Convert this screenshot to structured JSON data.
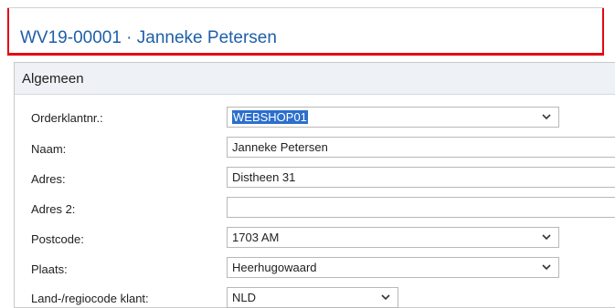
{
  "header": {
    "title": "WV19-00001 · Janneke Petersen"
  },
  "section": {
    "title": "Algemeen"
  },
  "fields": [
    {
      "label": "Orderklantnr.:",
      "value": "WEBSHOP01",
      "type": "select"
    },
    {
      "label": "Naam:",
      "value": "Janneke Petersen",
      "type": "text"
    },
    {
      "label": "Adres:",
      "value": "Distheen 31",
      "type": "text"
    },
    {
      "label": "Adres 2:",
      "value": "",
      "type": "text"
    },
    {
      "label": "Postcode:",
      "value": "1703 AM",
      "type": "select"
    },
    {
      "label": "Plaats:",
      "value": "Heerhugowaard",
      "type": "select"
    },
    {
      "label": "Land-/regiocode klant:",
      "value": "NLD",
      "type": "select"
    }
  ],
  "colors": {
    "accent": "#e40613",
    "title_text": "#1e5fa8",
    "selection": "#2c6fcc"
  },
  "icons": {
    "dropdown": "chevron-down-icon"
  }
}
